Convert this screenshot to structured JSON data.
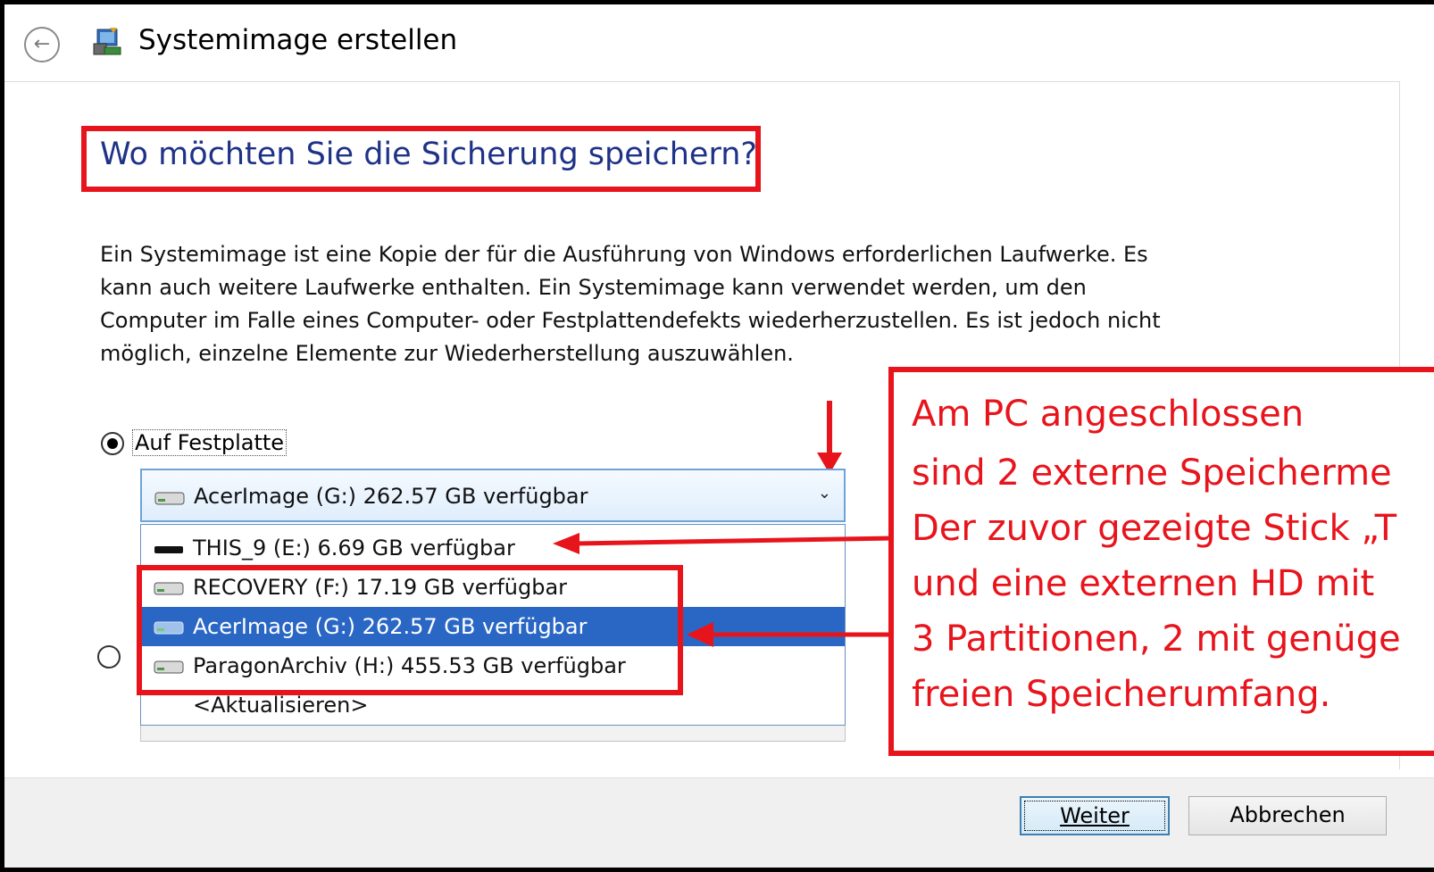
{
  "window": {
    "title": "Systemimage erstellen",
    "back_icon": "back-arrow-icon"
  },
  "page": {
    "heading": "Wo möchten Sie die Sicherung speichern?",
    "description": "Ein Systemimage ist eine Kopie der für die Ausführung von Windows erforderlichen Laufwerke. Es kann auch weitere Laufwerke enthalten. Ein Systemimage kann verwendet werden, um den Computer im Falle eines Computer- oder Festplattendefekts wiederherzustellen. Es ist jedoch nicht möglich, einzelne Elemente zur Wiederherstellung auszuwählen.",
    "description_lines": [
      "Ein Systemimage ist eine Kopie der für die Ausführung von Windows erforderlichen Laufwerke. Es",
      "kann auch weitere Laufwerke enthalten. Ein Systemimage kann verwendet werden, um den",
      "Computer im Falle eines Computer- oder Festplattendefekts wiederherzustellen. Es ist jedoch nicht",
      "möglich, einzelne Elemente zur Wiederherstellung auszuwählen."
    ]
  },
  "options": {
    "hard_disk": {
      "label": "Auf Festplatte",
      "checked": true
    },
    "second": {
      "checked": false
    }
  },
  "combo": {
    "selected": "AcerImage (G:)  262.57 GB verfügbar",
    "arrow_icon": "chevron-down-icon"
  },
  "dropdown": {
    "items": [
      {
        "label": "THIS_9 (E:)  6.69 GB verfügbar",
        "icon": "usb-stick-icon",
        "selected": false
      },
      {
        "label": "RECOVERY (F:)  17.19 GB verfügbar",
        "icon": "hard-drive-icon",
        "selected": false
      },
      {
        "label": "AcerImage (G:)  262.57 GB verfügbar",
        "icon": "hard-drive-icon",
        "selected": true
      },
      {
        "label": "ParagonArchiv (H:)  455.53 GB verfügbar",
        "icon": "hard-drive-icon",
        "selected": false
      },
      {
        "label": "<Aktualisieren>",
        "icon": "",
        "selected": false
      }
    ]
  },
  "annotation": {
    "lines": [
      "Am PC angeschlossen",
      "sind 2 externe Speicherme",
      "Der zuvor gezeigte Stick „T",
      "und eine externen HD mit",
      "3 Partitionen, 2 mit genüge",
      "freien Speicherumfang."
    ],
    "color": "#e8141c"
  },
  "footer": {
    "next_label": "Weiter",
    "cancel_label": "Abbrechen"
  },
  "colors": {
    "heading": "#1e3287",
    "selection": "#2a67c4",
    "annotation_red": "#e8141c"
  }
}
